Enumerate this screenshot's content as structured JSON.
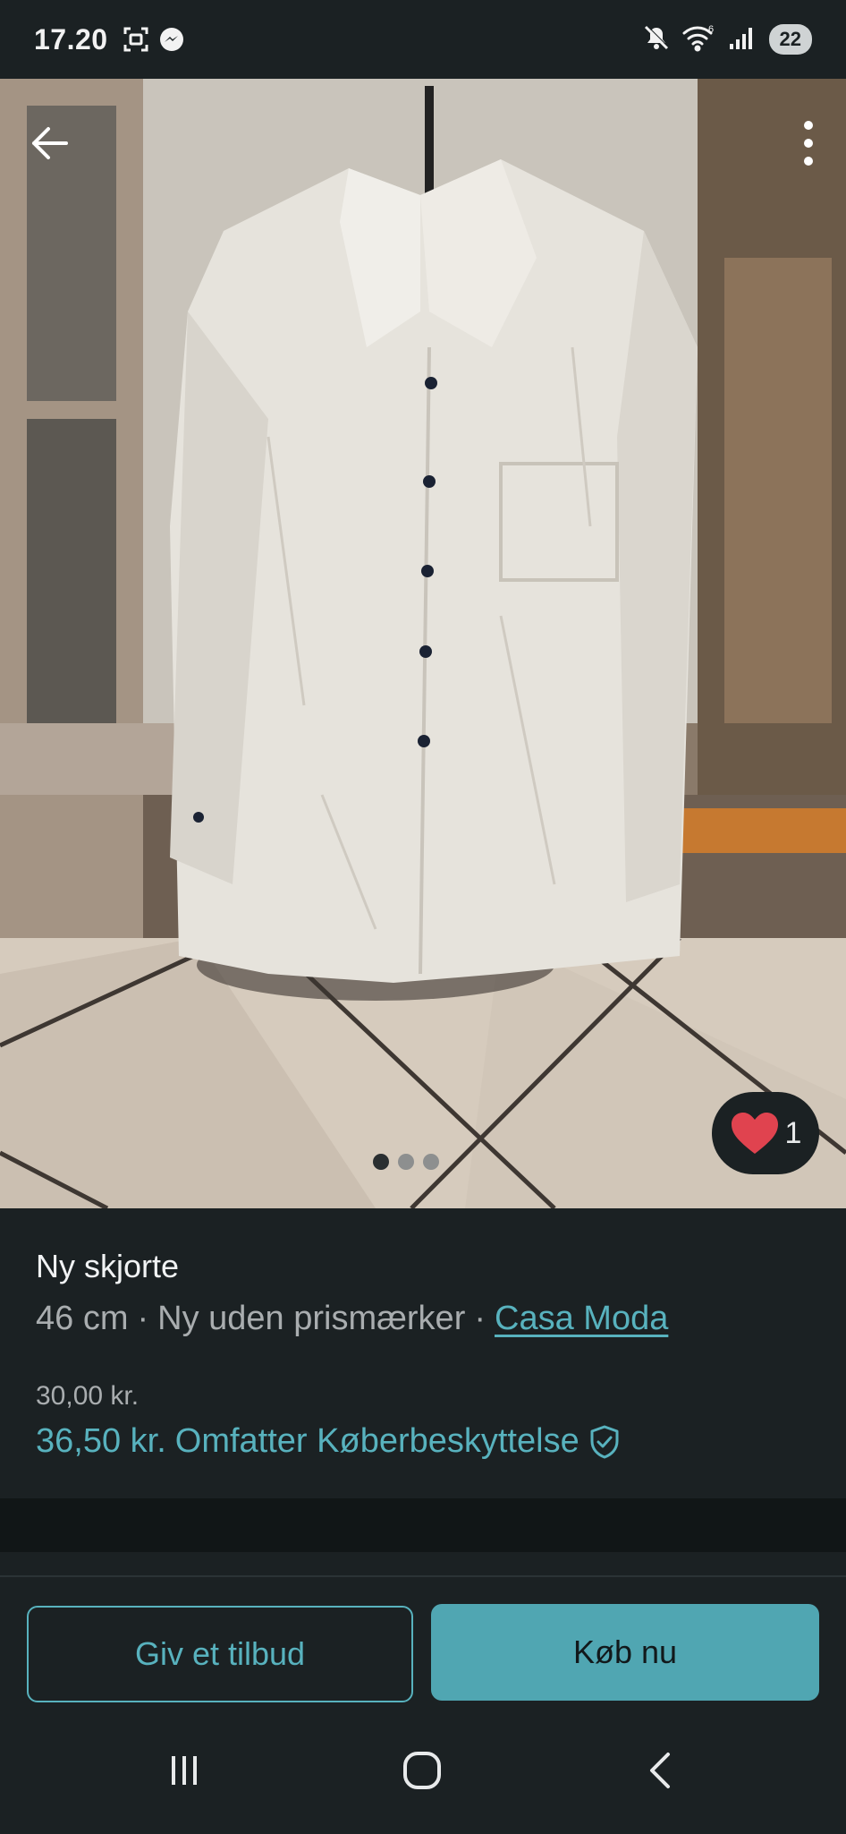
{
  "status_bar": {
    "time": "17.20",
    "battery": "22",
    "icons": [
      "screenshot-icon",
      "messenger-icon",
      "mute-icon",
      "wifi-icon",
      "signal-icon",
      "battery-icon"
    ]
  },
  "gallery": {
    "image_count": 3,
    "active_index": 0,
    "favorite_count": "1",
    "favorite_color": "#e0434f"
  },
  "item": {
    "title": "Ny skjorte",
    "size": "46 cm",
    "separator": "·",
    "condition": "Ny uden prismærker",
    "brand": "Casa Moda",
    "price": "30,00 kr.",
    "total_price": "36,50 kr.",
    "protection_label": "Omfatter Køberbeskyttelse"
  },
  "actions": {
    "offer_label": "Giv et tilbud",
    "buy_label": "Køb nu"
  },
  "colors": {
    "accent": "#58b2be",
    "background": "#1b2123"
  }
}
